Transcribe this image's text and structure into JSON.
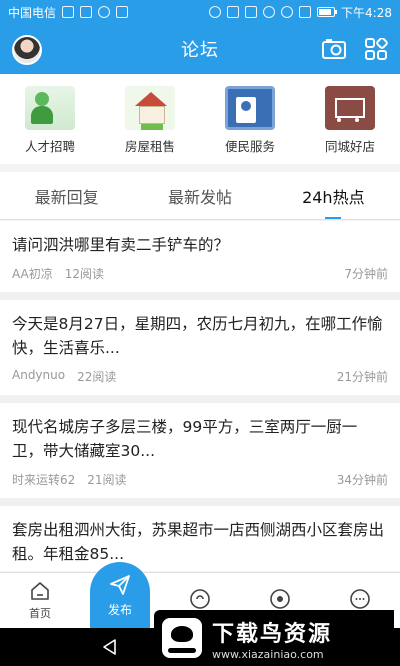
{
  "status_bar": {
    "carrier": "中国电信",
    "time": "下午4:28"
  },
  "header": {
    "title": "论坛",
    "avatar": "user-avatar",
    "actions": [
      "camera-icon",
      "grid-icon"
    ]
  },
  "categories": [
    {
      "label": "人才招聘",
      "icon": "job-icon"
    },
    {
      "label": "房屋租售",
      "icon": "house-icon"
    },
    {
      "label": "便民服务",
      "icon": "service-icon"
    },
    {
      "label": "同城好店",
      "icon": "cart-icon"
    }
  ],
  "tabs": [
    {
      "label": "最新回复",
      "active": false
    },
    {
      "label": "最新发帖",
      "active": false
    },
    {
      "label": "24h热点",
      "active": true
    }
  ],
  "posts": [
    {
      "title": "请问泗洪哪里有卖二手铲车的？",
      "author": "AA初凉",
      "reads": "12阅读",
      "time": "7分钟前"
    },
    {
      "title": "今天是8月27日，星期四，农历七月初九，在哪工作愉快，生活喜乐...",
      "author": "Andynuo",
      "reads": "22阅读",
      "time": "21分钟前"
    },
    {
      "title": "现代名城房子多层三楼，99平方，三室两厅一厨一卫，带大储藏室30...",
      "author": "时来运转62",
      "reads": "21阅读",
      "time": "34分钟前"
    },
    {
      "title": "套房出租泗州大街，苏果超市一店西侧湖西小区套房出租。年租金85...",
      "author": "",
      "reads": "",
      "time": ""
    }
  ],
  "bottom_nav": {
    "home": "首页",
    "publish": "发布"
  },
  "watermark": {
    "main": "下载鸟资源",
    "url": "www.xiazainiao.com"
  },
  "colors": {
    "primary": "#2a9de8"
  }
}
